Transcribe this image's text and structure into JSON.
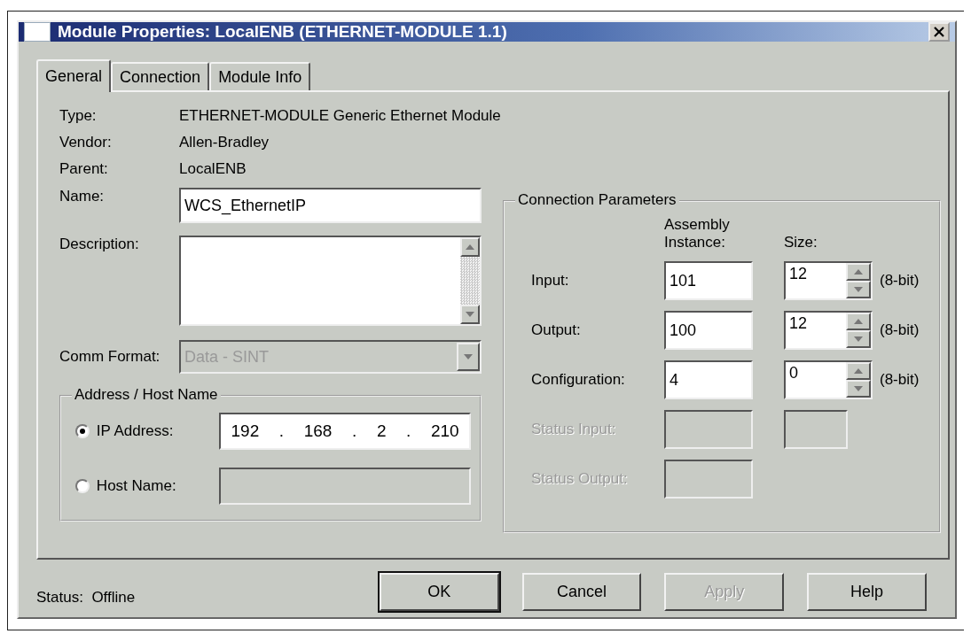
{
  "window": {
    "title": "Module Properties: LocalENB (ETHERNET-MODULE 1.1)"
  },
  "tabs": [
    {
      "label": "General",
      "selected": true
    },
    {
      "label": "Connection",
      "selected": false
    },
    {
      "label": "Module Info",
      "selected": false
    }
  ],
  "info": [
    {
      "label": "Type:",
      "value": "ETHERNET-MODULE Generic Ethernet Module"
    },
    {
      "label": "Vendor:",
      "value": "Allen-Bradley"
    },
    {
      "label": "Parent:",
      "value": "LocalENB"
    }
  ],
  "name_field": {
    "label": "Name:",
    "value": "WCS_EthernetIP"
  },
  "description": {
    "label": "Description:"
  },
  "comm_format": {
    "label": "Comm Format:",
    "value": "Data - SINT",
    "disabled": true
  },
  "address_group": {
    "title": "Address / Host Name",
    "options": [
      {
        "label": "IP Address:",
        "selected": true,
        "kind": "ip",
        "octets": [
          "192",
          "168",
          "2",
          "210"
        ],
        "separator": "."
      },
      {
        "label": "Host Name:",
        "selected": false,
        "kind": "text"
      }
    ]
  },
  "connection_parameters": {
    "title": "Connection Parameters",
    "instance_header": "Assembly Instance:",
    "size_header": "Size:",
    "rows": [
      {
        "label": "Input:",
        "instance": "101",
        "size": "12",
        "unit": "(8-bit)",
        "disabled": false,
        "kind": "spinner"
      },
      {
        "label": "Output:",
        "instance": "100",
        "size": "12",
        "unit": "(8-bit)",
        "disabled": false,
        "kind": "spinner"
      },
      {
        "label": "Configuration:",
        "instance": "4",
        "size": "0",
        "unit": "(8-bit)",
        "disabled": false,
        "kind": "spinner"
      },
      {
        "label": "Status Input:",
        "disabled": true,
        "kind": "box"
      },
      {
        "label": "Status Output:",
        "disabled": true,
        "kind": "none"
      }
    ]
  },
  "status": {
    "label": "Status:",
    "value": "Offline"
  },
  "buttons": [
    {
      "label": "OK",
      "default": true,
      "disabled": false
    },
    {
      "label": "Cancel",
      "default": false,
      "disabled": false
    },
    {
      "label": "Apply",
      "default": false,
      "disabled": true
    },
    {
      "label": "Help",
      "default": false,
      "disabled": false
    }
  ]
}
